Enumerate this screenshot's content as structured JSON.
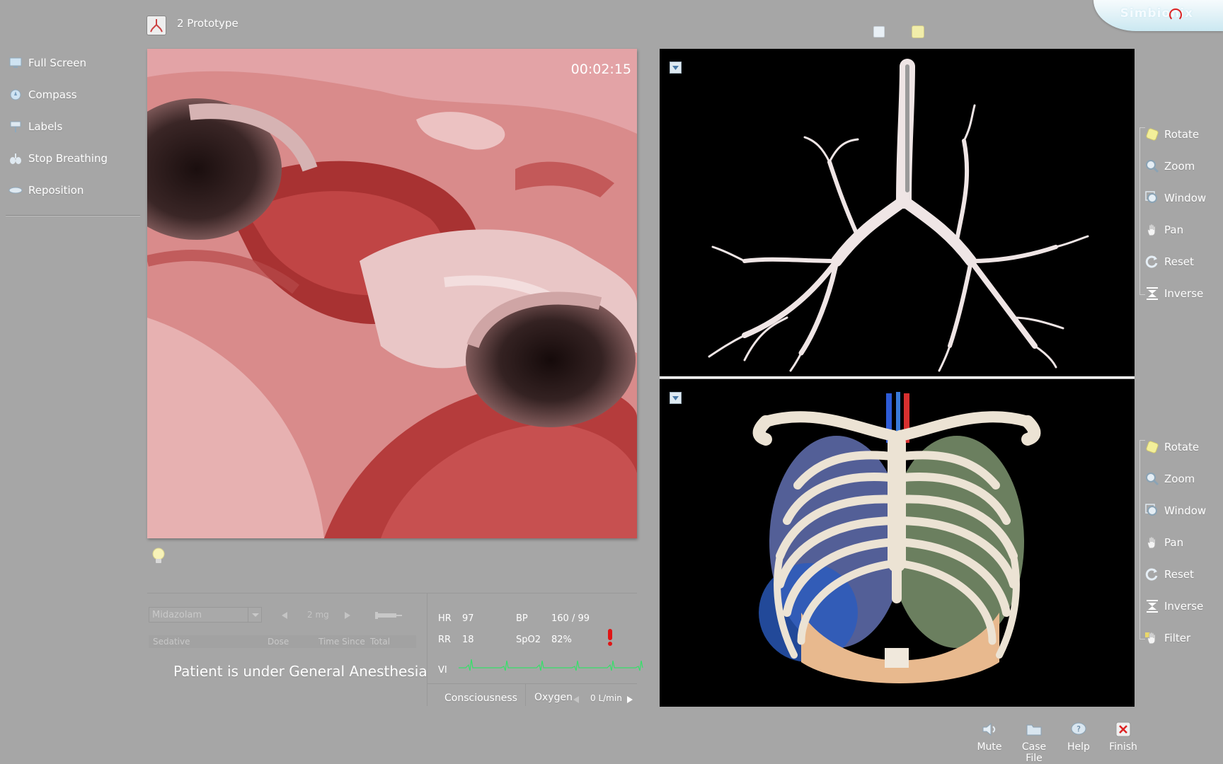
{
  "header": {
    "title": "2 Prototype",
    "brand": "Simbionix"
  },
  "left_menu": [
    {
      "label": "Full Screen",
      "icon": "monitor-icon"
    },
    {
      "label": "Compass",
      "icon": "compass-icon"
    },
    {
      "label": "Labels",
      "icon": "label-pin-icon"
    },
    {
      "label": "Stop Breathing",
      "icon": "lungs-icon"
    },
    {
      "label": "Reposition",
      "icon": "reposition-icon"
    }
  ],
  "viewport": {
    "timer": "00:02:15"
  },
  "tools_top": [
    "Rotate",
    "Zoom",
    "Window",
    "Pan",
    "Reset",
    "Inverse"
  ],
  "tools_bottom": [
    "Rotate",
    "Zoom",
    "Window",
    "Pan",
    "Reset",
    "Inverse",
    "Filter"
  ],
  "drug": {
    "selected": "Midazolam",
    "dose": "2 mg",
    "columns": [
      "Sedative",
      "Dose",
      "Time Since",
      "Total"
    ],
    "status": "Patient is under General Anesthesia"
  },
  "vitals": {
    "hr_label": "HR",
    "hr": "97",
    "bp_label": "BP",
    "bp": "160 / 99",
    "rr_label": "RR",
    "rr": "18",
    "spo2_label": "SpO2",
    "spo2": "82%",
    "ecg_label": "VI",
    "consciousness": "Consciousness",
    "oxygen_label": "Oxygen",
    "oxygen_value": "0 L/min"
  },
  "bottom_buttons": [
    "Mute",
    "Case File",
    "Help",
    "Finish"
  ]
}
